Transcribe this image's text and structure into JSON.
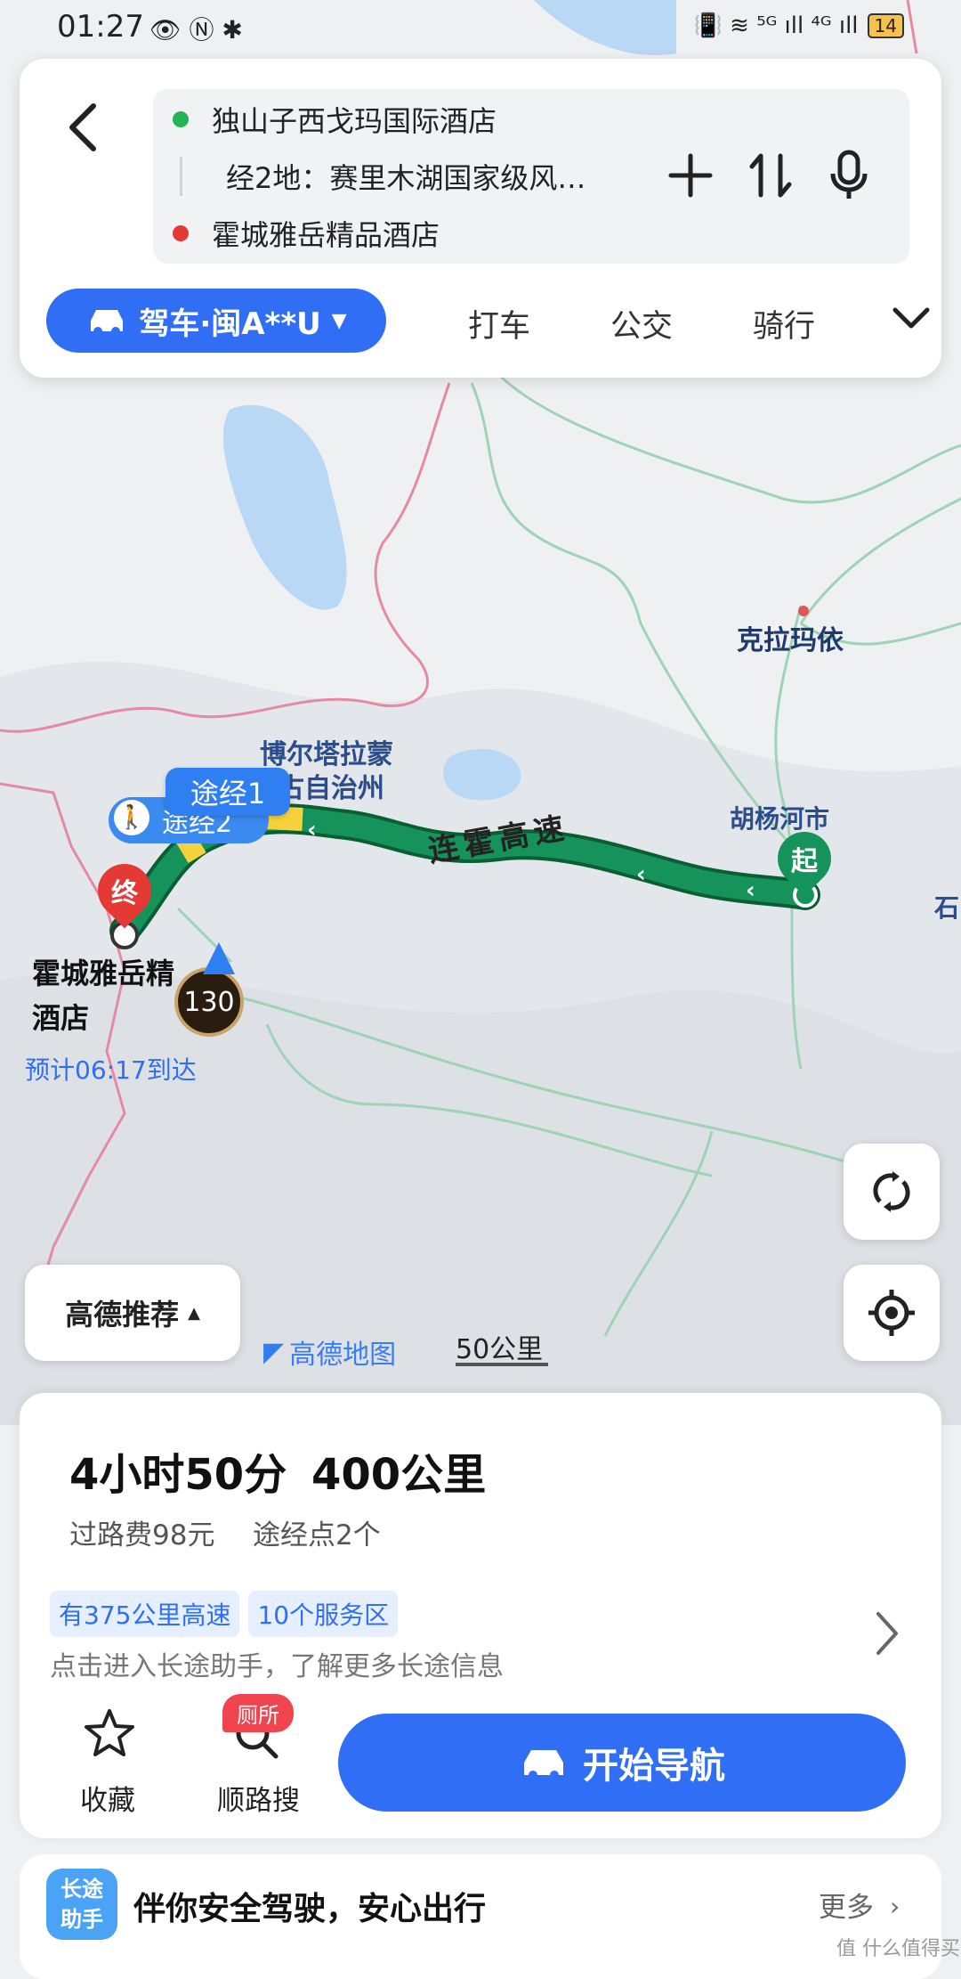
{
  "status_bar": {
    "time": "01:27",
    "icons": "👁 Ⓝ ✱",
    "right_icons": "📳 ≋ ⁵ᴳ ıll ⁴ᴳ ıll",
    "battery": "14"
  },
  "route": {
    "origin": "独山子西戈玛国际酒店",
    "via": "经2地：赛里木湖国家级风…",
    "destination": "霍城雅岳精品酒店",
    "origin_color": "#22b455",
    "dest_color": "#e53935"
  },
  "modes": {
    "active": "驾车·闽A**U",
    "taxi": "打车",
    "bus": "公交",
    "bike": "骑行"
  },
  "map": {
    "city_label": "克拉玛依",
    "region_label_1": "博尔塔拉蒙",
    "region_label_2": "古自治州",
    "huyanghe": "胡杨河市",
    "road_label": "连霍高速",
    "edge_label": "石",
    "via1": "途经1",
    "via2": "途经2",
    "start_marker": "起",
    "end_marker": "终",
    "dest_name_1": "霍城雅岳精",
    "dest_name_2": "酒店",
    "eta": "预计06:17到达",
    "speed_limit": "130",
    "recommend": "高德推荐",
    "logo": "高德地图",
    "scale": "50公里"
  },
  "summary": {
    "duration": "4小时50分",
    "distance": "400公里",
    "toll": "过路费98元",
    "waypoints": "途经点2个",
    "chip1": "有375公里高速",
    "chip2": "10个服务区",
    "assist_hint": "点击进入长途助手，了解更多长途信息",
    "favorite": "收藏",
    "search_along": "顺路搜",
    "toilet_badge": "厕所",
    "start_nav": "开始导航"
  },
  "banner": {
    "badge_line1": "长途",
    "badge_line2": "助手",
    "text": "伴你安全驾驶，安心出行",
    "more": "更多",
    "watermark": "值 什么值得买"
  },
  "colors": {
    "accent": "#2f6ef5",
    "route": "#0f8a4f",
    "toilet": "#f0454f"
  }
}
